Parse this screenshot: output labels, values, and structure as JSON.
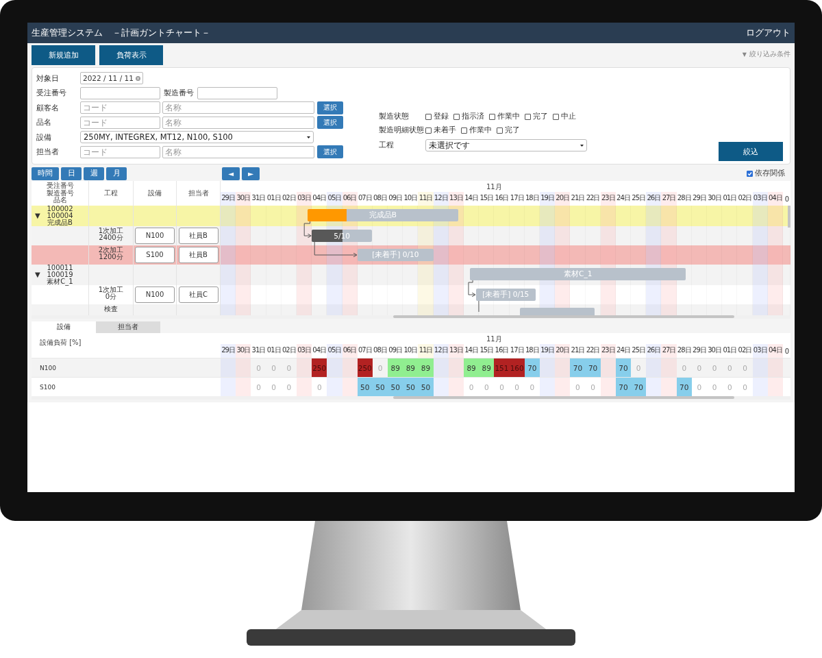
{
  "app": {
    "title": "生産管理システム",
    "subtitle": "－計画ガントチャート－",
    "logout": "ログアウト"
  },
  "toolbar": {
    "buttons": [
      "新規追加",
      "負荷表示"
    ],
    "filter_toggle_icon": "▼",
    "filter_toggle": "絞り込み条件"
  },
  "filter": {
    "rows": [
      {
        "kind": "date",
        "label": "対象日",
        "value": "2022 / 11 / 11"
      },
      {
        "kind": "pair",
        "label": "受注番号",
        "second_label": "製造番号"
      },
      {
        "kind": "lookup",
        "label": "顧客名",
        "code_placeholder": "コード",
        "name_placeholder": "名称",
        "button": "選択"
      },
      {
        "kind": "lookup",
        "label": "品名",
        "code_placeholder": "コード",
        "name_placeholder": "名称",
        "button": "選択"
      },
      {
        "kind": "select",
        "label": "設備",
        "value": "250MY, INTEGREX, MT12, N100, S100"
      },
      {
        "kind": "lookup",
        "label": "担当者",
        "code_placeholder": "コード",
        "name_placeholder": "名称",
        "button": "選択"
      }
    ],
    "status": {
      "label": "製造状態",
      "options": [
        {
          "label": "登録",
          "checked": false
        },
        {
          "label": "指示済",
          "checked": false
        },
        {
          "label": "作業中",
          "checked": false
        },
        {
          "label": "完了",
          "checked": false
        },
        {
          "label": "中止",
          "checked": false
        }
      ]
    },
    "detail_status": {
      "label": "製造明細状態",
      "options": [
        {
          "label": "未着手",
          "checked": false
        },
        {
          "label": "作業中",
          "checked": false
        },
        {
          "label": "完了",
          "checked": false
        }
      ]
    },
    "process": {
      "label": "工程",
      "value": "未選択です"
    },
    "submit": "絞込"
  },
  "gantt": {
    "scale_buttons": [
      "時間",
      "日",
      "週",
      "月"
    ],
    "prev": "◄",
    "next": "►",
    "dependencies": {
      "label": "依存関係",
      "checked": true
    },
    "columns": [
      [
        "受注番号",
        "製造番号",
        "品名"
      ],
      [
        "工程"
      ],
      [
        "設備"
      ],
      [
        "担当者"
      ]
    ],
    "months": [
      {
        "days": [
          {
            "label": "29日",
            "kind": "sat"
          },
          {
            "label": "30日",
            "kind": "sun"
          },
          {
            "label": "31日",
            "kind": "day"
          }
        ]
      },
      {
        "label": "11月",
        "days": [
          {
            "label": "01日",
            "kind": "day"
          },
          {
            "label": "02日",
            "kind": "day"
          },
          {
            "label": "03日",
            "kind": "sun"
          },
          {
            "label": "04日",
            "kind": "day"
          },
          {
            "label": "05日",
            "kind": "sat"
          },
          {
            "label": "06日",
            "kind": "sun"
          },
          {
            "label": "07日",
            "kind": "day"
          },
          {
            "label": "08日",
            "kind": "day"
          },
          {
            "label": "09日",
            "kind": "day"
          },
          {
            "label": "10日",
            "kind": "day"
          },
          {
            "label": "11日",
            "kind": "today"
          },
          {
            "label": "12日",
            "kind": "sat"
          },
          {
            "label": "13日",
            "kind": "sun"
          },
          {
            "label": "14日",
            "kind": "day"
          },
          {
            "label": "15日",
            "kind": "day"
          },
          {
            "label": "16日",
            "kind": "day"
          },
          {
            "label": "17日",
            "kind": "day"
          },
          {
            "label": "18日",
            "kind": "day"
          },
          {
            "label": "19日",
            "kind": "sat"
          },
          {
            "label": "20日",
            "kind": "sun"
          },
          {
            "label": "21日",
            "kind": "day"
          },
          {
            "label": "22日",
            "kind": "day"
          },
          {
            "label": "23日",
            "kind": "sun"
          },
          {
            "label": "24日",
            "kind": "day"
          },
          {
            "label": "25日",
            "kind": "day"
          },
          {
            "label": "26日",
            "kind": "sat"
          },
          {
            "label": "27日",
            "kind": "sun"
          },
          {
            "label": "28日",
            "kind": "day"
          },
          {
            "label": "29日",
            "kind": "day"
          },
          {
            "label": "30日",
            "kind": "day"
          }
        ]
      },
      {
        "days": [
          {
            "label": "01日",
            "kind": "day"
          },
          {
            "label": "02日",
            "kind": "day"
          },
          {
            "label": "03日",
            "kind": "sat"
          },
          {
            "label": "04日",
            "kind": "sun"
          },
          {
            "label": "0",
            "kind": "day"
          }
        ]
      }
    ],
    "rows": [
      {
        "kind": "group",
        "expanded": true,
        "toggle": "▼",
        "title": [
          "100002",
          "100004",
          "完成品B"
        ],
        "color": "#f7f5a6",
        "bar": {
          "label": "完成品B",
          "level": 0.26
        }
      },
      {
        "kind": "process",
        "title": [
          "1次加工",
          "2400分"
        ],
        "equipment": "N100",
        "person": "社員B",
        "linked": true,
        "bar": {
          "label": "5/10",
          "level": 0.51
        }
      },
      {
        "kind": "process",
        "title": [
          "2次加工",
          "1200分"
        ],
        "equipment": "S100",
        "person": "社員B",
        "color": "#f3b9b6",
        "linked": true,
        "bar": {
          "label": "[未着手] 0/10"
        }
      },
      {
        "kind": "group",
        "expanded": true,
        "toggle": "▼",
        "title": [
          "100011",
          "100019",
          "素材C_1"
        ],
        "bar": {
          "label": "素材C_1"
        }
      },
      {
        "kind": "process",
        "title": [
          "1次加工",
          "0分"
        ],
        "equipment": "N100",
        "person": "社員C",
        "linked": true,
        "bar": {
          "label": "[未着手] 0/15"
        }
      },
      {
        "kind": "process",
        "title": [
          "検査"
        ],
        "linked": true,
        "bar": {}
      }
    ]
  },
  "load": {
    "tabs": [
      {
        "label": "設備",
        "selected": true
      },
      {
        "label": "担当者",
        "selected": false
      }
    ],
    "heading": "設備負荷 [%]",
    "months": [
      {
        "days": [
          {
            "label": "29日",
            "kind": "sat"
          },
          {
            "label": "30日",
            "kind": "sun"
          },
          {
            "label": "31日",
            "kind": "day"
          }
        ]
      },
      {
        "label": "11月",
        "days": [
          {
            "label": "01日",
            "kind": "day"
          },
          {
            "label": "02日",
            "kind": "day"
          },
          {
            "label": "03日",
            "kind": "sun"
          },
          {
            "label": "04日",
            "kind": "day"
          },
          {
            "label": "05日",
            "kind": "sat"
          },
          {
            "label": "06日",
            "kind": "sun"
          },
          {
            "label": "07日",
            "kind": "day"
          },
          {
            "label": "08日",
            "kind": "day"
          },
          {
            "label": "09日",
            "kind": "day"
          },
          {
            "label": "10日",
            "kind": "day"
          },
          {
            "label": "11日",
            "kind": "today"
          },
          {
            "label": "12日",
            "kind": "sat"
          },
          {
            "label": "13日",
            "kind": "sun"
          },
          {
            "label": "14日",
            "kind": "day"
          },
          {
            "label": "15日",
            "kind": "day"
          },
          {
            "label": "16日",
            "kind": "day"
          },
          {
            "label": "17日",
            "kind": "day"
          },
          {
            "label": "18日",
            "kind": "day"
          },
          {
            "label": "19日",
            "kind": "sat"
          },
          {
            "label": "20日",
            "kind": "sun"
          },
          {
            "label": "21日",
            "kind": "day"
          },
          {
            "label": "22日",
            "kind": "day"
          },
          {
            "label": "23日",
            "kind": "sun"
          },
          {
            "label": "24日",
            "kind": "day"
          },
          {
            "label": "25日",
            "kind": "day"
          },
          {
            "label": "26日",
            "kind": "sat"
          },
          {
            "label": "27日",
            "kind": "sun"
          },
          {
            "label": "28日",
            "kind": "day"
          },
          {
            "label": "29日",
            "kind": "day"
          },
          {
            "label": "30日",
            "kind": "day"
          }
        ]
      },
      {
        "days": [
          {
            "label": "01日",
            "kind": "day"
          },
          {
            "label": "02日",
            "kind": "day"
          },
          {
            "label": "03日",
            "kind": "sat"
          },
          {
            "label": "04日",
            "kind": "sun"
          },
          {
            "label": "0",
            "kind": "day"
          }
        ]
      }
    ],
    "rows": [
      {
        "name": "N100",
        "cells": [
          null,
          null,
          {
            "value": "0"
          },
          {
            "value": "0"
          },
          {
            "value": "0"
          },
          null,
          {
            "value": "250",
            "color": "#b22222"
          },
          null,
          null,
          {
            "value": "250",
            "color": "#b22222"
          },
          {
            "value": "0"
          },
          {
            "value": "89",
            "color": "#90ee90"
          },
          {
            "value": "89",
            "color": "#90ee90"
          },
          {
            "value": "89",
            "color": "#90ee90"
          },
          null,
          null,
          {
            "value": "89",
            "color": "#90ee90"
          },
          {
            "value": "89",
            "color": "#90ee90"
          },
          {
            "value": "151",
            "color": "#b22222"
          },
          {
            "value": "160",
            "color": "#b22222"
          },
          {
            "value": "70",
            "color": "#87ceeb"
          },
          null,
          null,
          {
            "value": "70",
            "color": "#87ceeb"
          },
          {
            "value": "70",
            "color": "#87ceeb"
          },
          null,
          {
            "value": "70",
            "color": "#87ceeb"
          },
          {
            "value": "0"
          },
          null,
          null,
          {
            "value": "0"
          },
          {
            "value": "0"
          },
          {
            "value": "0"
          },
          {
            "value": "0"
          },
          {
            "value": "0"
          },
          null,
          null,
          null
        ]
      },
      {
        "name": "S100",
        "cells": [
          null,
          null,
          {
            "value": "0"
          },
          {
            "value": "0"
          },
          {
            "value": "0"
          },
          null,
          {
            "value": "0"
          },
          null,
          null,
          {
            "value": "50",
            "color": "#87ceeb"
          },
          {
            "value": "50",
            "color": "#87ceeb"
          },
          {
            "value": "50",
            "color": "#87ceeb"
          },
          {
            "value": "50",
            "color": "#87ceeb"
          },
          {
            "value": "50",
            "color": "#87ceeb"
          },
          null,
          null,
          {
            "value": "0"
          },
          {
            "value": "0"
          },
          {
            "value": "0"
          },
          {
            "value": "0"
          },
          {
            "value": "0"
          },
          null,
          null,
          {
            "value": "0"
          },
          {
            "value": "0"
          },
          null,
          {
            "value": "70",
            "color": "#87ceeb"
          },
          {
            "value": "70",
            "color": "#87ceeb"
          },
          null,
          null,
          {
            "value": "70",
            "color": "#87ceeb"
          },
          {
            "value": "0"
          },
          {
            "value": "0"
          },
          {
            "value": "0"
          },
          {
            "value": "0"
          },
          null,
          null,
          null
        ]
      }
    ]
  }
}
